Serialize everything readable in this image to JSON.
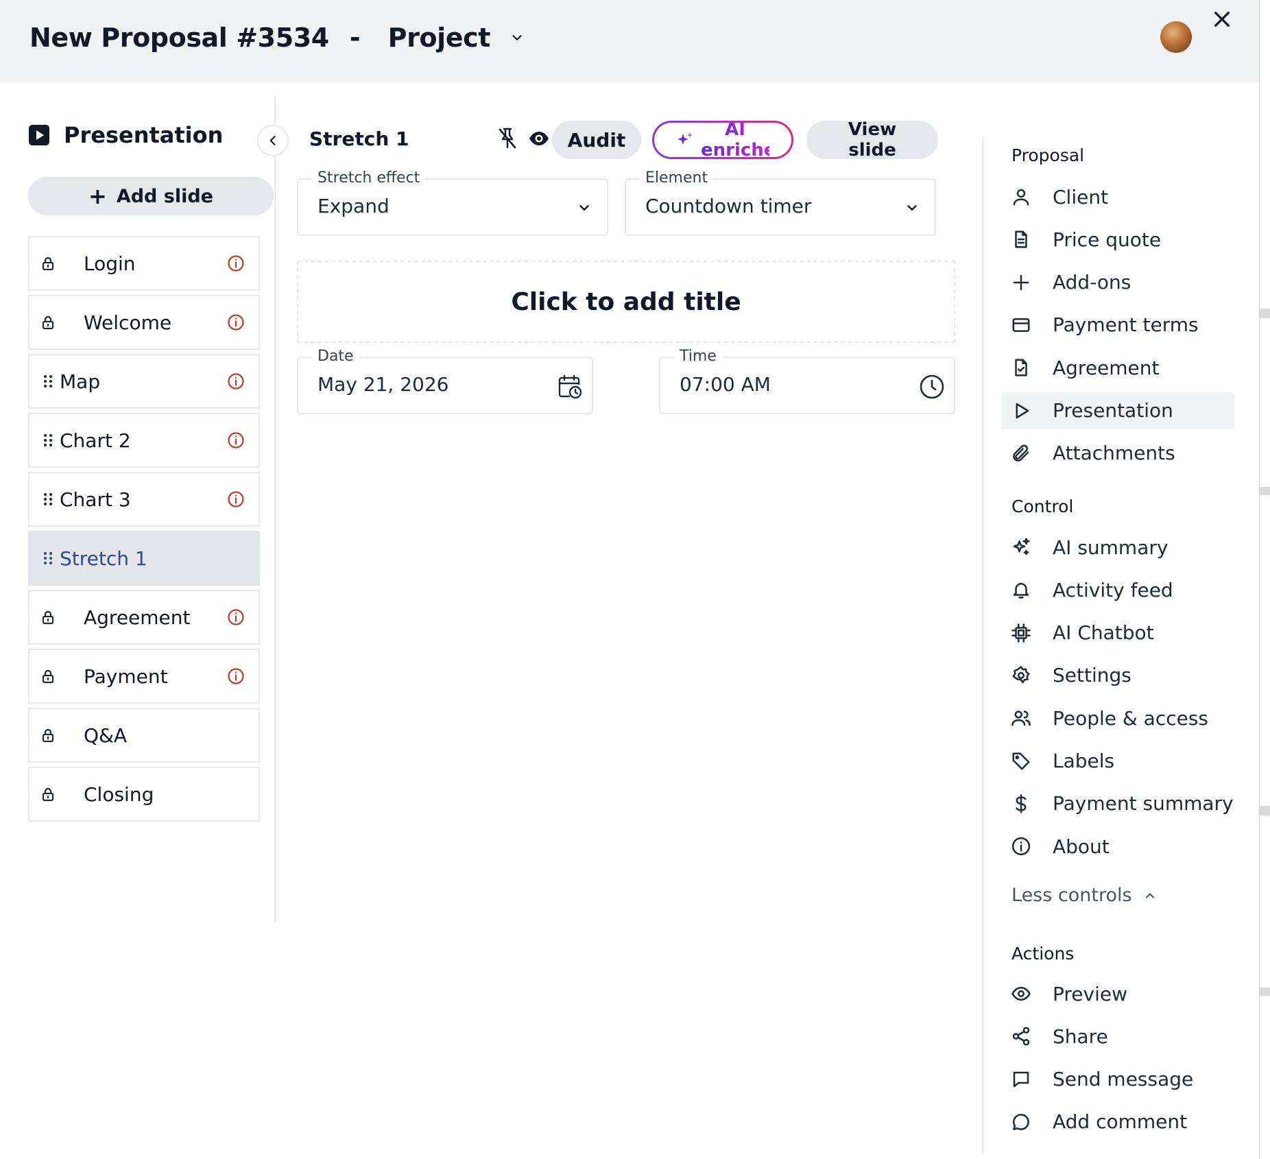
{
  "header": {
    "proposal_title": "New Proposal #3534",
    "separator": "-",
    "project_label": "Project"
  },
  "left_panel": {
    "title": "Presentation",
    "add_slide_label": "Add slide",
    "slides": [
      {
        "label": "Login",
        "kind": "locked",
        "warning": true
      },
      {
        "label": "Welcome",
        "kind": "locked",
        "warning": true
      },
      {
        "label": "Map",
        "kind": "draggable",
        "warning": true
      },
      {
        "label": "Chart 2",
        "kind": "draggable",
        "warning": true
      },
      {
        "label": "Chart 3",
        "kind": "draggable",
        "warning": true
      },
      {
        "label": "Stretch 1",
        "kind": "draggable",
        "warning": false,
        "active": true
      },
      {
        "label": "Agreement",
        "kind": "locked",
        "warning": true
      },
      {
        "label": "Payment",
        "kind": "locked",
        "warning": true
      },
      {
        "label": "Q&A",
        "kind": "locked",
        "warning": false
      },
      {
        "label": "Closing",
        "kind": "locked",
        "warning": false
      }
    ]
  },
  "editor": {
    "slide_name": "Stretch 1",
    "audit_label": "Audit",
    "ai_enricher_label": "AI enricher",
    "view_slide_label": "View slide",
    "stretch_effect": {
      "label": "Stretch effect",
      "value": "Expand"
    },
    "element": {
      "label": "Element",
      "value": "Countdown timer"
    },
    "title_placeholder": "Click to add title",
    "date": {
      "label": "Date",
      "value": "May 21, 2026"
    },
    "time": {
      "label": "Time",
      "value": "07:00 AM"
    }
  },
  "right_panel": {
    "proposal_section": "Proposal",
    "proposal_items": [
      {
        "label": "Client",
        "icon": "user-icon"
      },
      {
        "label": "Price quote",
        "icon": "document-icon"
      },
      {
        "label": "Add-ons",
        "icon": "plus-icon"
      },
      {
        "label": "Payment terms",
        "icon": "credit-card-icon"
      },
      {
        "label": "Agreement",
        "icon": "signed-document-icon"
      },
      {
        "label": "Presentation",
        "icon": "play-icon",
        "active": true
      },
      {
        "label": "Attachments",
        "icon": "paperclip-icon"
      }
    ],
    "control_section": "Control",
    "control_items": [
      {
        "label": "AI summary",
        "icon": "sparkles-icon"
      },
      {
        "label": "Activity feed",
        "icon": "bell-icon"
      },
      {
        "label": "AI Chatbot",
        "icon": "chip-icon"
      },
      {
        "label": "Settings",
        "icon": "gear-icon"
      },
      {
        "label": "People & access",
        "icon": "people-icon"
      },
      {
        "label": "Labels",
        "icon": "tag-icon"
      },
      {
        "label": "Payment summary",
        "icon": "dollar-icon"
      },
      {
        "label": "About",
        "icon": "info-icon"
      }
    ],
    "less_controls_label": "Less controls",
    "actions_section": "Actions",
    "action_items": [
      {
        "label": "Preview",
        "icon": "eye-icon"
      },
      {
        "label": "Share",
        "icon": "share-icon"
      },
      {
        "label": "Send message",
        "icon": "message-square-icon"
      },
      {
        "label": "Add comment",
        "icon": "comment-icon"
      }
    ]
  },
  "colors": {
    "header_bg": "#f1f2f3",
    "active_slide_text": "#2f4896",
    "warning_red": "#c0392b",
    "ai_gradient_start": "#7c3aed",
    "ai_gradient_end": "#db2777"
  }
}
